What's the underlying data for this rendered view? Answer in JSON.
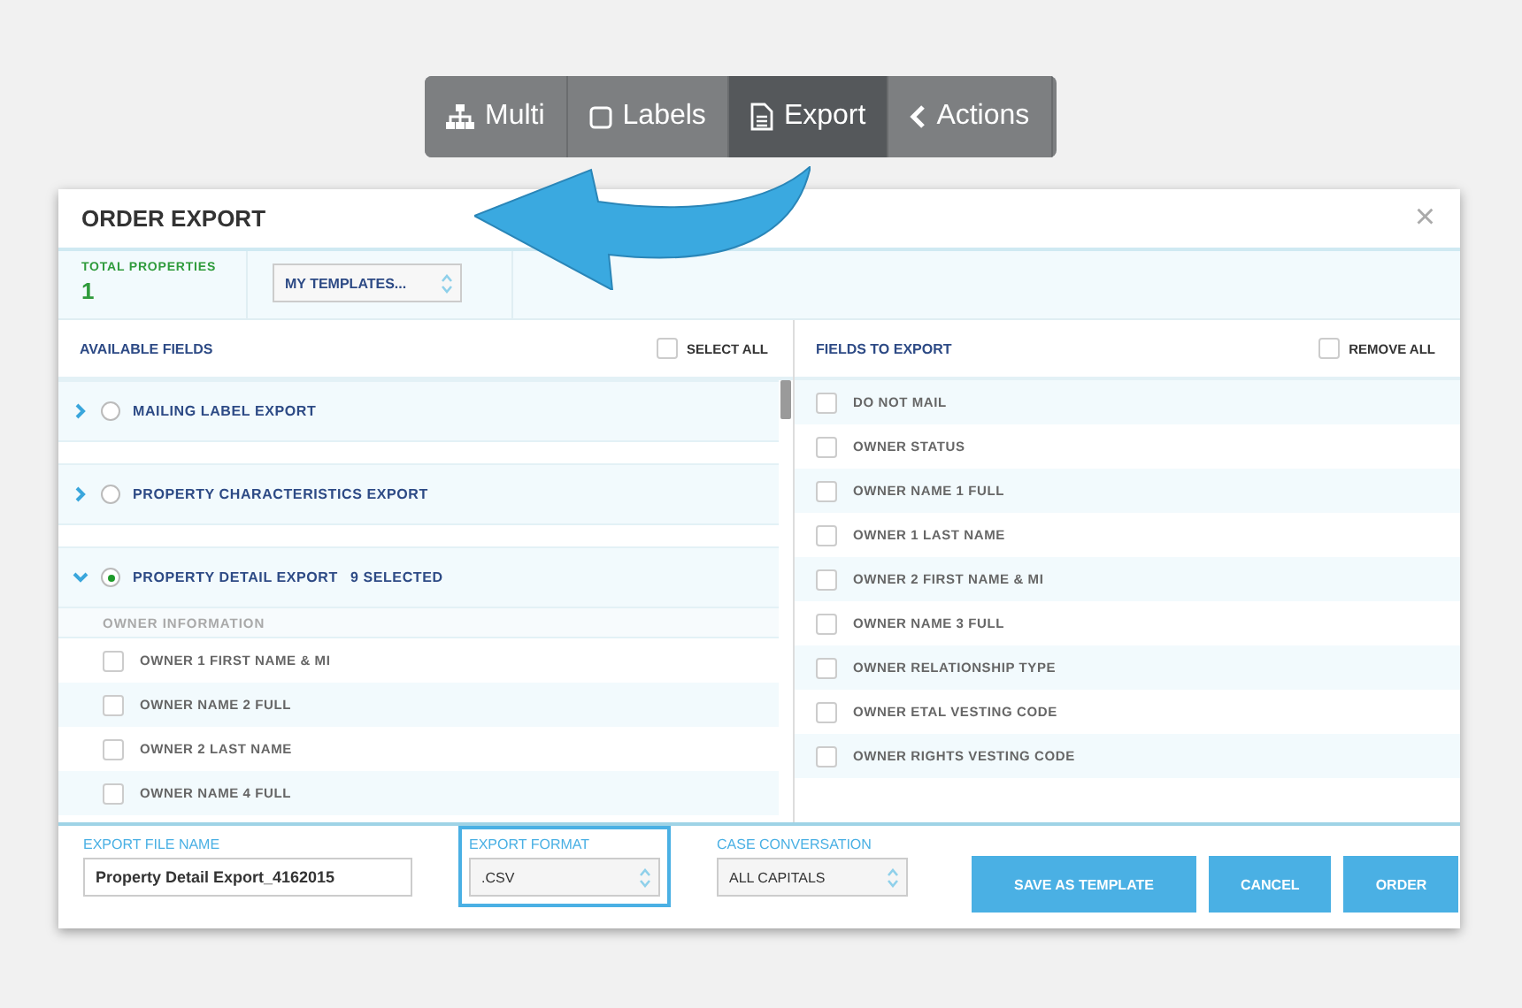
{
  "toolbar": {
    "buttons": [
      {
        "kind": "multi",
        "label": "Multi",
        "selected": false
      },
      {
        "kind": "labels",
        "label": "Labels",
        "selected": false
      },
      {
        "kind": "export",
        "label": "Export",
        "selected": true
      },
      {
        "kind": "actions",
        "label": "Actions",
        "selected": false
      }
    ]
  },
  "dialog": {
    "title": "ORDER EXPORT",
    "close": "×",
    "summary": {
      "label": "TOTAL PROPERTIES",
      "value": "1",
      "templates": "MY TEMPLATES..."
    },
    "available": {
      "heading": "AVAILABLE FIELDS",
      "select_all": {
        "label": "SELECT ALL",
        "checked": false
      },
      "groups": [
        {
          "label": "MAILING LABEL EXPORT",
          "expanded": false,
          "selected": false
        },
        {
          "label": "PROPERTY CHARACTERISTICS EXPORT",
          "expanded": false,
          "selected": false
        },
        {
          "label": "PROPERTY DETAIL EXPORT",
          "count": "9 SELECTED",
          "expanded": true,
          "selected": true,
          "children": [
            {
              "kind": "section",
              "label": "OWNER INFORMATION"
            },
            {
              "kind": "field",
              "label": "OWNER 1 FIRST NAME & MI",
              "checked": false
            },
            {
              "kind": "field",
              "label": "OWNER NAME 2 FULL",
              "checked": false
            },
            {
              "kind": "field",
              "label": "OWNER 2 LAST NAME",
              "checked": false
            },
            {
              "kind": "field",
              "label": "OWNER NAME 4 FULL",
              "checked": false
            }
          ]
        }
      ]
    },
    "export": {
      "heading": "FIELDS TO EXPORT",
      "remove_all": {
        "label": "REMOVE ALL",
        "checked": false
      },
      "fields": [
        {
          "label": "DO NOT MAIL",
          "checked": false
        },
        {
          "label": "OWNER STATUS",
          "checked": false
        },
        {
          "label": "OWNER NAME 1 FULL",
          "checked": false
        },
        {
          "label": "OWNER 1 LAST NAME",
          "checked": false
        },
        {
          "label": "OWNER 2 FIRST NAME & MI",
          "checked": false
        },
        {
          "label": "OWNER NAME 3 FULL",
          "checked": false
        },
        {
          "label": "OWNER RELATIONSHIP TYPE",
          "checked": false
        },
        {
          "label": "OWNER ETAL VESTING CODE",
          "checked": false
        },
        {
          "label": "OWNER RIGHTS VESTING CODE",
          "checked": false
        }
      ]
    },
    "footer": {
      "file_name": {
        "label": "EXPORT FILE NAME",
        "value": "Property Detail Export_4162015"
      },
      "format": {
        "label": "EXPORT FORMAT",
        "value": ".CSV",
        "focused": true
      },
      "case": {
        "label": "CASE CONVERSATION",
        "value": "ALL CAPITALS",
        "focused": false
      },
      "buttons": [
        "SAVE AS TEMPLATE",
        "CANCEL",
        "ORDER"
      ]
    }
  }
}
